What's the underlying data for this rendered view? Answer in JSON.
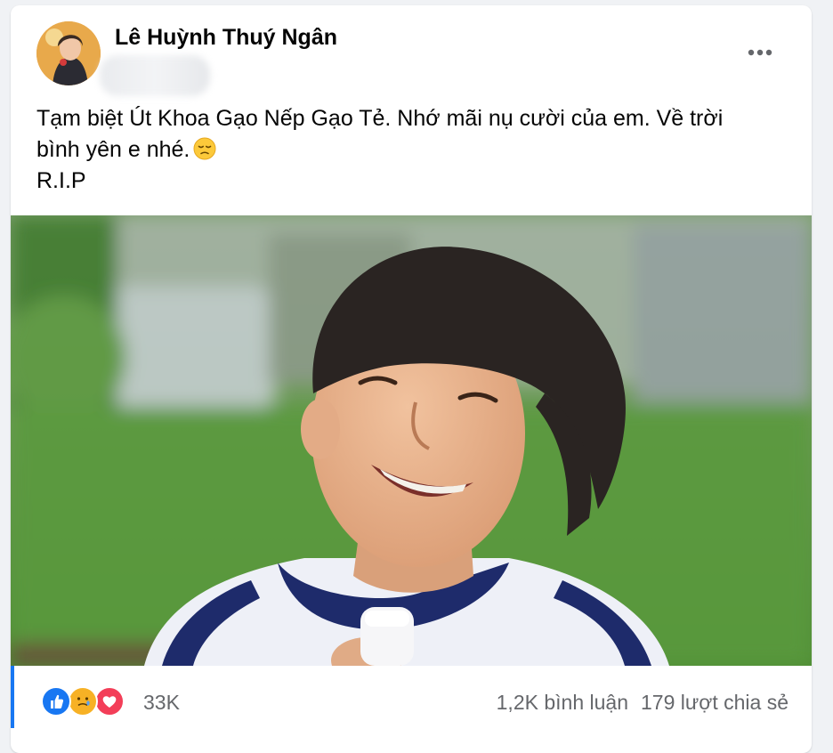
{
  "post": {
    "author": "Lê Huỳnh Thuý Ngân",
    "text_line1": "Tạm biệt Út Khoa Gạo Nếp Gạo Tẻ. Nhớ mãi nụ cười của em. Về trời",
    "text_line2": "bình yên e nhé.",
    "text_line3": "R.I.P",
    "text_emoji": "disappointed-face-emoji"
  },
  "reactions": {
    "icons": [
      "like-icon",
      "care-icon",
      "love-icon"
    ],
    "count": "33K",
    "comments": "1,2K bình luận",
    "shares": "179 lượt chia sẻ"
  },
  "colors": {
    "accent": "#1877f2",
    "secondary_text": "#65676b",
    "love": "#f33e58",
    "care": "#f7b125"
  }
}
